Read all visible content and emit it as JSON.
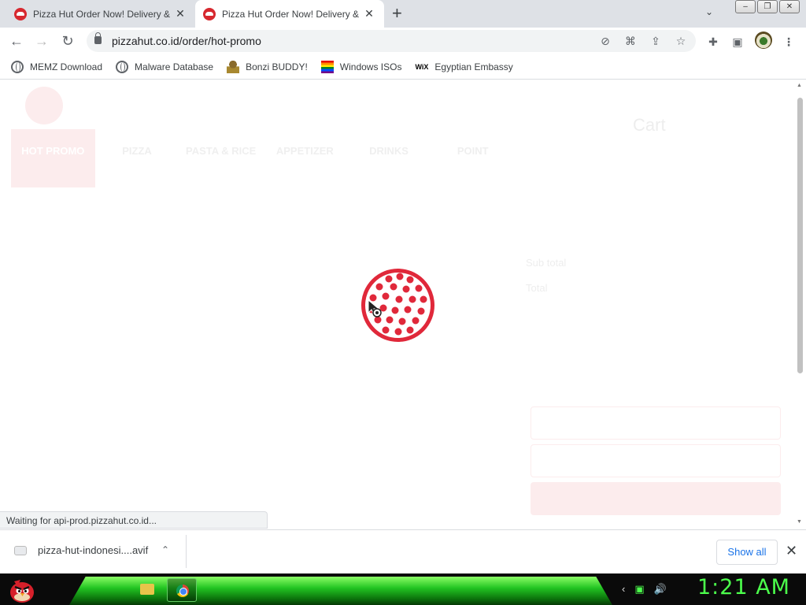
{
  "browser": {
    "tabs": [
      {
        "title": "Pizza Hut Order Now! Delivery &",
        "active": false
      },
      {
        "title": "Pizza Hut Order Now! Delivery &",
        "active": true
      }
    ],
    "url": "pizzahut.co.id/order/hot-promo",
    "bookmarks": [
      {
        "label": "MEMZ Download",
        "icon": "globe-icon"
      },
      {
        "label": "Malware Database",
        "icon": "globe-icon"
      },
      {
        "label": "Bonzi BUDDY!",
        "icon": "bonzi-icon"
      },
      {
        "label": "Windows ISOs",
        "icon": "rainbow-flag-icon"
      },
      {
        "label": "Egyptian Embassy",
        "icon": "wix-icon"
      }
    ]
  },
  "page": {
    "categories": [
      "HOT PROMO",
      "PIZZA",
      "PASTA & RICE",
      "APPETIZER",
      "DRINKS",
      "POINT"
    ],
    "cart": {
      "title": "Cart",
      "subtotal_label": "Sub total",
      "total_label": "Total"
    },
    "brand_color": "#d7282f"
  },
  "status": {
    "text": "Waiting for api-prod.pizzahut.co.id..."
  },
  "download": {
    "filename": "pizza-hut-indonesi....avif",
    "show_all": "Show all"
  },
  "taskbar": {
    "clock": "1:21 AM"
  }
}
